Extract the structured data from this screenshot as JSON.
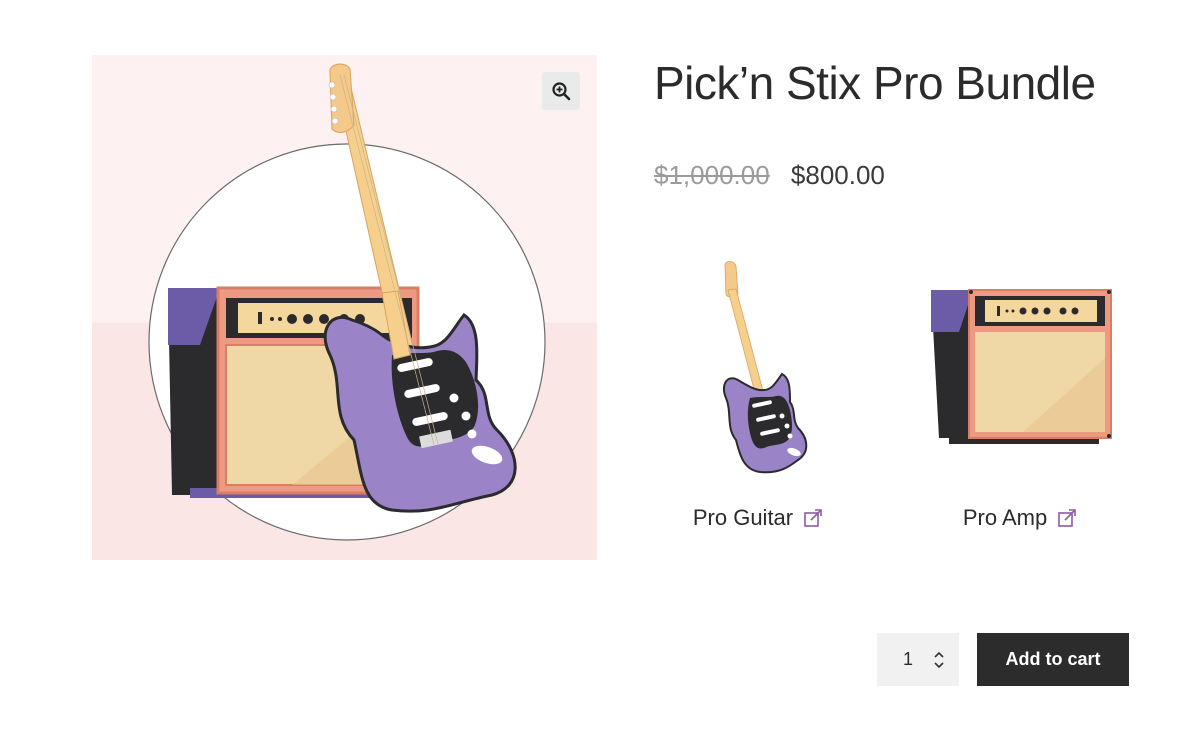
{
  "product": {
    "title": "Pick’n Stix Pro Bundle",
    "regular_price": "$1,000.00",
    "sale_price": "$800.00"
  },
  "gallery": {
    "zoom_icon": "zoom-in-icon"
  },
  "bundle": {
    "items": [
      {
        "label": "Pro Guitar",
        "icon": "external-link-icon"
      },
      {
        "label": "Pro Amp",
        "icon": "external-link-icon"
      }
    ]
  },
  "cart": {
    "quantity": "1",
    "add_to_cart_label": "Add to cart"
  },
  "colors": {
    "accent_link_icon": "#8e5aa1",
    "button_background": "#2c2c2c",
    "guitar_body": "#9a83c6",
    "amp_frame": "#ee9a82"
  }
}
